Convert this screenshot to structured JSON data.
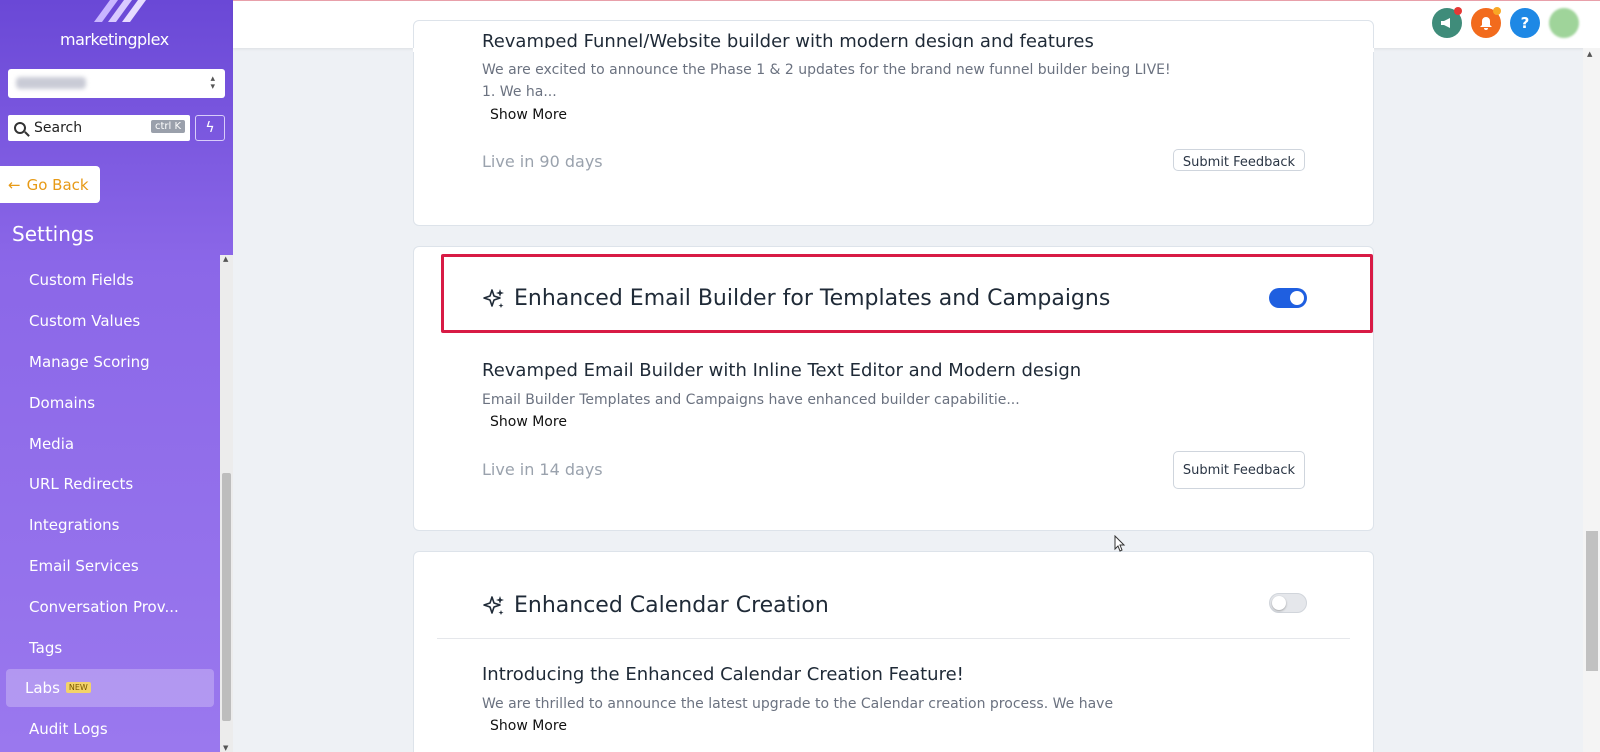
{
  "sidebar": {
    "logo_text": "marketingplex",
    "search_label": "Search",
    "search_shortcut": "ctrl K",
    "go_back": "Go Back",
    "settings_title": "Settings",
    "items": [
      {
        "label": "Custom Fields"
      },
      {
        "label": "Custom Values"
      },
      {
        "label": "Manage Scoring"
      },
      {
        "label": "Domains"
      },
      {
        "label": "Media"
      },
      {
        "label": "URL Redirects"
      },
      {
        "label": "Integrations"
      },
      {
        "label": "Email Services"
      },
      {
        "label": "Conversation Prov..."
      },
      {
        "label": "Tags"
      },
      {
        "label": "Labs",
        "badge": "NEW",
        "active": true
      },
      {
        "label": "Audit Logs"
      }
    ]
  },
  "topbar": {
    "icons": [
      {
        "name": "megaphone-icon",
        "color": "#3f8c7a"
      },
      {
        "name": "bell-icon",
        "color": "#f26b1d"
      },
      {
        "name": "help-icon",
        "color": "#1e88e5",
        "glyph": "?"
      },
      {
        "name": "avatar",
        "color": "#9fd49a"
      }
    ]
  },
  "cards": [
    {
      "title": "Revamped Funnel/Website builder with modern design and features",
      "desc_line1": "We are excited to announce the Phase 1 & 2 updates for the brand new funnel builder being LIVE!",
      "desc_line2": "1. We ha...",
      "show_more": "Show More",
      "live": "Live in 90 days",
      "feedback": "Submit Feedback"
    },
    {
      "title": "Enhanced Email Builder for Templates and Campaigns",
      "enabled": true,
      "subtitle": "Revamped Email Builder with Inline Text Editor and Modern design",
      "desc": "Email Builder Templates and Campaigns have enhanced builder capabilitie...",
      "show_more": "Show More",
      "live": "Live in 14 days",
      "feedback": "Submit Feedback"
    },
    {
      "title": "Enhanced Calendar Creation",
      "enabled": false,
      "subtitle": "Introducing the Enhanced Calendar Creation Feature!",
      "desc": "We are thrilled to announce the latest upgrade to the Calendar creation process. We have",
      "show_more": "Show More"
    }
  ]
}
